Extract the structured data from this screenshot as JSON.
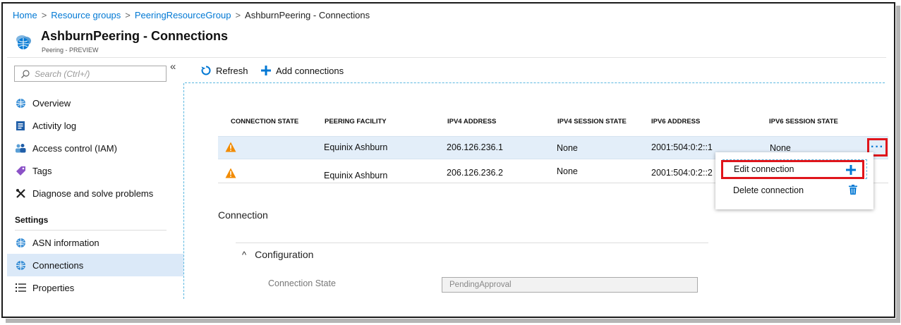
{
  "breadcrumb": {
    "items": [
      "Home",
      "Resource groups",
      "PeeringResourceGroup"
    ],
    "current": "AshburnPeering - Connections",
    "separator": ">"
  },
  "header": {
    "title": "AshburnPeering  - Connections",
    "subtitle": "Peering - PREVIEW",
    "icon": "peering-globe-icon"
  },
  "sidebar": {
    "search_placeholder": "Search (Ctrl+/)",
    "collapse_glyph": "«",
    "items": [
      {
        "label": "Overview",
        "icon": "globe-icon"
      },
      {
        "label": "Activity log",
        "icon": "log-icon"
      },
      {
        "label": "Access control (IAM)",
        "icon": "people-icon"
      },
      {
        "label": "Tags",
        "icon": "tag-icon"
      },
      {
        "label": "Diagnose and solve problems",
        "icon": "wrench-icon"
      }
    ],
    "settings_header": "Settings",
    "settings_items": [
      {
        "label": "ASN information",
        "icon": "globe-icon"
      },
      {
        "label": "Connections",
        "icon": "globe-icon",
        "active": true
      },
      {
        "label": "Properties",
        "icon": "list-icon"
      }
    ]
  },
  "toolbar": {
    "refresh_label": "Refresh",
    "add_label": "Add connections"
  },
  "table": {
    "columns": [
      "CONNECTION STATE",
      "PEERING FACILITY",
      "IPV4 ADDRESS",
      "IPV4 SESSION STATE",
      "IPV6 ADDRESS",
      "IPV6 SESSION STATE"
    ],
    "rows": [
      {
        "state_icon": "warning-icon",
        "facility": "Equinix Ashburn",
        "ipv4": "206.126.236.1",
        "ipv4_state": "None",
        "ipv6": "2001:504:0:2::1",
        "ipv6_state": "None",
        "selected": true
      },
      {
        "state_icon": "warning-icon",
        "facility": "Equinix Ashburn",
        "ipv4": "206.126.236.2",
        "ipv4_state": "None",
        "ipv6": "2001:504:0:2::2",
        "ipv6_state": ""
      }
    ],
    "more_glyph": "···"
  },
  "context_menu": {
    "edit_label": "Edit connection",
    "delete_label": "Delete connection"
  },
  "detail": {
    "section_label": "Connection",
    "config_label": "Configuration",
    "config_chevron": "^",
    "field_label": "Connection State",
    "field_value": "PendingApproval"
  },
  "colors": {
    "link": "#0078d4",
    "highlight_red": "#e0151b",
    "selected_row": "#e3eef9",
    "warning": "#f28b00"
  }
}
